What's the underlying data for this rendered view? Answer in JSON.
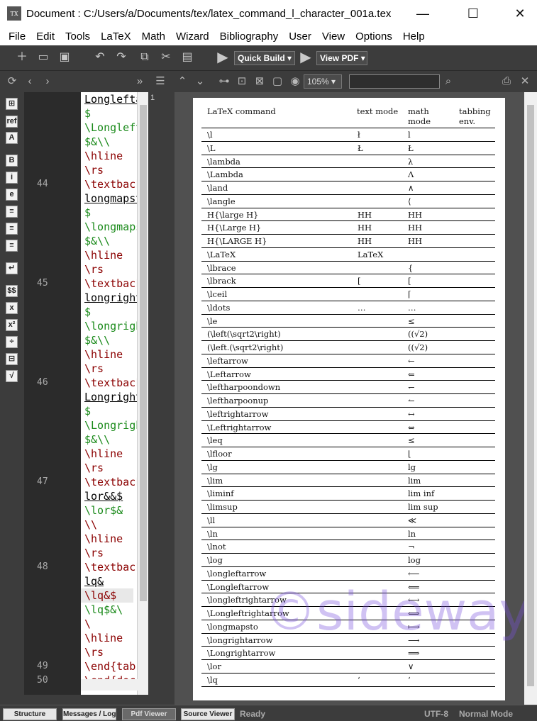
{
  "window": {
    "title": "Document : C:/Users/a/Documents/tex/latex_command_l_character_001a.tex",
    "minimize": "—",
    "maximize": "☐",
    "close": "✕"
  },
  "menu": [
    "File",
    "Edit",
    "Tools",
    "LaTeX",
    "Math",
    "Wizard",
    "Bibliography",
    "User",
    "View",
    "Options",
    "Help"
  ],
  "toolbar": {
    "quick_build": "Quick Build",
    "view_pdf": "View PDF"
  },
  "pdf_toolbar": {
    "zoom": "105%",
    "search_placeholder": ""
  },
  "editor": {
    "line_numbers": [
      {
        "n": "44",
        "row": 6
      },
      {
        "n": "45",
        "row": 13
      },
      {
        "n": "46",
        "row": 20
      },
      {
        "n": "47",
        "row": 27
      },
      {
        "n": "48",
        "row": 33
      },
      {
        "n": "49",
        "row": 40
      },
      {
        "n": "50",
        "row": 41
      }
    ],
    "lines": [
      {
        "t": "Longlefta",
        "c": "u"
      },
      {
        "t": "$",
        "c": "m"
      },
      {
        "t": "\\Longlefta",
        "c": "m"
      },
      {
        "t": "$&\\\\",
        "c": "m"
      },
      {
        "t": "\\hline",
        "c": "kw"
      },
      {
        "t": "\\rs",
        "c": "kw"
      },
      {
        "t": "\\textback",
        "c": "kw"
      },
      {
        "t": "longmapsto",
        "c": "u"
      },
      {
        "t": "$",
        "c": "m"
      },
      {
        "t": "\\longmaps",
        "c": "m"
      },
      {
        "t": "$&\\\\",
        "c": "m"
      },
      {
        "t": "\\hline",
        "c": "kw"
      },
      {
        "t": "\\rs",
        "c": "kw"
      },
      {
        "t": "\\textback",
        "c": "kw"
      },
      {
        "t": "longright",
        "c": "u"
      },
      {
        "t": "$",
        "c": "m"
      },
      {
        "t": "\\longright",
        "c": "m"
      },
      {
        "t": "$&\\\\",
        "c": "m"
      },
      {
        "t": "\\hline",
        "c": "kw"
      },
      {
        "t": "\\rs",
        "c": "kw"
      },
      {
        "t": "\\textback",
        "c": "kw"
      },
      {
        "t": "Longright",
        "c": "u"
      },
      {
        "t": "$",
        "c": "m"
      },
      {
        "t": "\\Longright",
        "c": "m"
      },
      {
        "t": "$&\\\\",
        "c": "m"
      },
      {
        "t": "\\hline",
        "c": "kw"
      },
      {
        "t": "\\rs",
        "c": "kw"
      },
      {
        "t": "\\textback",
        "c": "kw"
      },
      {
        "t": "lor&&$",
        "c": "u"
      },
      {
        "t": "\\lor$&",
        "c": "m"
      },
      {
        "t": "\\\\",
        "c": "kw"
      },
      {
        "t": "\\hline",
        "c": "kw"
      },
      {
        "t": "\\rs",
        "c": "kw"
      },
      {
        "t": "\\textback",
        "c": "kw"
      },
      {
        "t": "lq&",
        "c": "u"
      },
      {
        "t": "\\lq&$",
        "c": "hl"
      },
      {
        "t": "\\lq$&\\",
        "c": "m"
      },
      {
        "t": "\\",
        "c": "kw"
      },
      {
        "t": "\\hline",
        "c": "kw"
      },
      {
        "t": "\\rs",
        "c": "kw"
      },
      {
        "t": "\\end{tab",
        "c": "kw"
      },
      {
        "t": "\\end{doc",
        "c": "kw"
      }
    ]
  },
  "pdf": {
    "page_label": "1",
    "headers": [
      "LaTeX command",
      "text mode",
      "math mode",
      "tabbing env."
    ],
    "rows": [
      [
        "\\l",
        "ł",
        "l"
      ],
      [
        "\\L",
        "Ł",
        "Ł"
      ],
      [
        "\\lambda",
        "",
        "λ"
      ],
      [
        "\\Lambda",
        "",
        "Λ"
      ],
      [
        "\\land",
        "",
        "∧"
      ],
      [
        "\\langle",
        "",
        "⟨"
      ],
      [
        "H{\\large H}",
        "HH",
        "HH"
      ],
      [
        "H{\\Large H}",
        "HH",
        "HH"
      ],
      [
        "H{\\LARGE H}",
        "HH",
        "HH"
      ],
      [
        "\\LaTeX",
        "LaTeX",
        ""
      ],
      [
        "\\lbrace",
        "",
        "{"
      ],
      [
        "\\lbrack",
        "[",
        "["
      ],
      [
        "\\lceil",
        "",
        "⌈"
      ],
      [
        "\\ldots",
        "…",
        "…"
      ],
      [
        "\\le",
        "",
        "≤"
      ],
      [
        "(\\left(\\sqrt2\\right)",
        "",
        "((√2)"
      ],
      [
        "(\\left.(\\sqrt2\\right)",
        "",
        "((√2)"
      ],
      [
        "\\leftarrow",
        "",
        "←"
      ],
      [
        "\\Leftarrow",
        "",
        "⇐"
      ],
      [
        "\\leftharpoondown",
        "",
        "↽"
      ],
      [
        "\\leftharpoonup",
        "",
        "↼"
      ],
      [
        "\\leftrightarrow",
        "",
        "↔"
      ],
      [
        "\\Leftrightarrow",
        "",
        "⇔"
      ],
      [
        "\\leq",
        "",
        "≤"
      ],
      [
        "\\lfloor",
        "",
        "⌊"
      ],
      [
        "\\lg",
        "",
        "lg"
      ],
      [
        "\\lim",
        "",
        "lim"
      ],
      [
        "\\liminf",
        "",
        "lim inf"
      ],
      [
        "\\limsup",
        "",
        "lim sup"
      ],
      [
        "\\ll",
        "",
        "≪"
      ],
      [
        "\\ln",
        "",
        "ln"
      ],
      [
        "\\lnot",
        "",
        "¬"
      ],
      [
        "\\log",
        "",
        "log"
      ],
      [
        "\\longleftarrow",
        "",
        "⟵"
      ],
      [
        "\\Longleftarrow",
        "",
        "⟸"
      ],
      [
        "\\longleftrightarrow",
        "",
        "⟷"
      ],
      [
        "\\Longleftrightarrow",
        "",
        "⟺"
      ],
      [
        "\\longmapsto",
        "",
        "⟼"
      ],
      [
        "\\longrightarrow",
        "",
        "⟶"
      ],
      [
        "\\Longrightarrow",
        "",
        "⟹"
      ],
      [
        "\\lor",
        "",
        "∨"
      ],
      [
        "\\lq",
        "‘",
        "‘"
      ]
    ],
    "watermark": "©sideway"
  },
  "status": {
    "tabs": [
      "Structure",
      "Messages / Log",
      "Pdf Viewer",
      "Source Viewer"
    ],
    "state": "Ready",
    "encoding": "UTF-8",
    "mode": "Normal Mode"
  },
  "left_icons": [
    "⊞",
    "ref",
    "A",
    "B",
    "i",
    "e",
    "≡",
    "≡",
    "≡",
    "↵",
    "$$",
    "x",
    "x²",
    "÷",
    "⊟",
    "√"
  ]
}
